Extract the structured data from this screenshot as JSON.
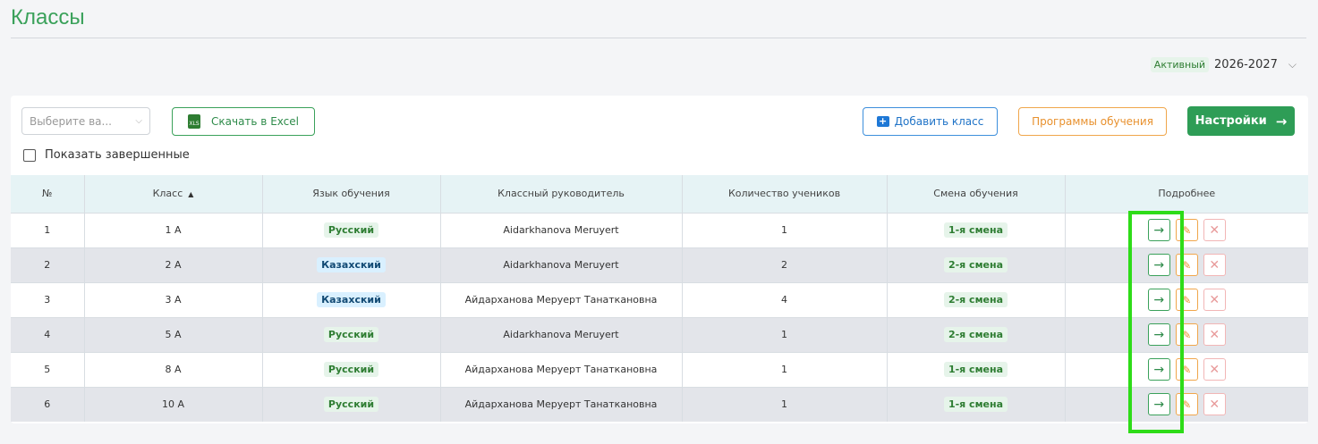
{
  "page": {
    "title": "Классы"
  },
  "year": {
    "status": "Активный",
    "value": "2026-2027",
    "chevron": "⌄"
  },
  "toolbar": {
    "select_placeholder": "Выберите ва...",
    "excel_label": "Скачать в Excel",
    "excel_icon_text": "XLS",
    "add_label": "Добавить класс",
    "programs_label": "Программы обучения",
    "settings_label": "Настройки",
    "show_finished_label": "Показать завершенные"
  },
  "table": {
    "headers": [
      "№",
      "Класс",
      "Язык обучения",
      "Классный руководитель",
      "Количество учеников",
      "Смена обучения",
      "Подробнее"
    ],
    "sort_indicator": "▲",
    "rows": [
      {
        "num": "1",
        "class": "1 A",
        "lang": "Русский",
        "teacher": "Aidarkhanova Meruyert",
        "count": "1",
        "shift": "1-я смена"
      },
      {
        "num": "2",
        "class": "2 A",
        "lang": "Казахский",
        "teacher": "Aidarkhanova Meruyert",
        "count": "2",
        "shift": "2-я смена"
      },
      {
        "num": "3",
        "class": "3 A",
        "lang": "Казахский",
        "teacher": "Айдарханова Меруерт Танаткановна",
        "count": "4",
        "shift": "2-я смена"
      },
      {
        "num": "4",
        "class": "5 A",
        "lang": "Русский",
        "teacher": "Aidarkhanova Meruyert",
        "count": "1",
        "shift": "2-я смена"
      },
      {
        "num": "5",
        "class": "8 A",
        "lang": "Русский",
        "teacher": "Айдарханова Меруерт Танаткановна",
        "count": "1",
        "shift": "1-я смена"
      },
      {
        "num": "6",
        "class": "10 A",
        "lang": "Русский",
        "teacher": "Айдарханова Меруерт Танаткановна",
        "count": "1",
        "shift": "1-я смена"
      }
    ]
  },
  "icons": {
    "go": "arrow-right-icon",
    "edit": "pencil-icon",
    "delete": "close-icon"
  },
  "colors": {
    "brand_green": "#3aa15a",
    "highlight": "#2edc18",
    "kz_badge": "#d9f0ff",
    "ru_badge": "#e6f4ea"
  }
}
